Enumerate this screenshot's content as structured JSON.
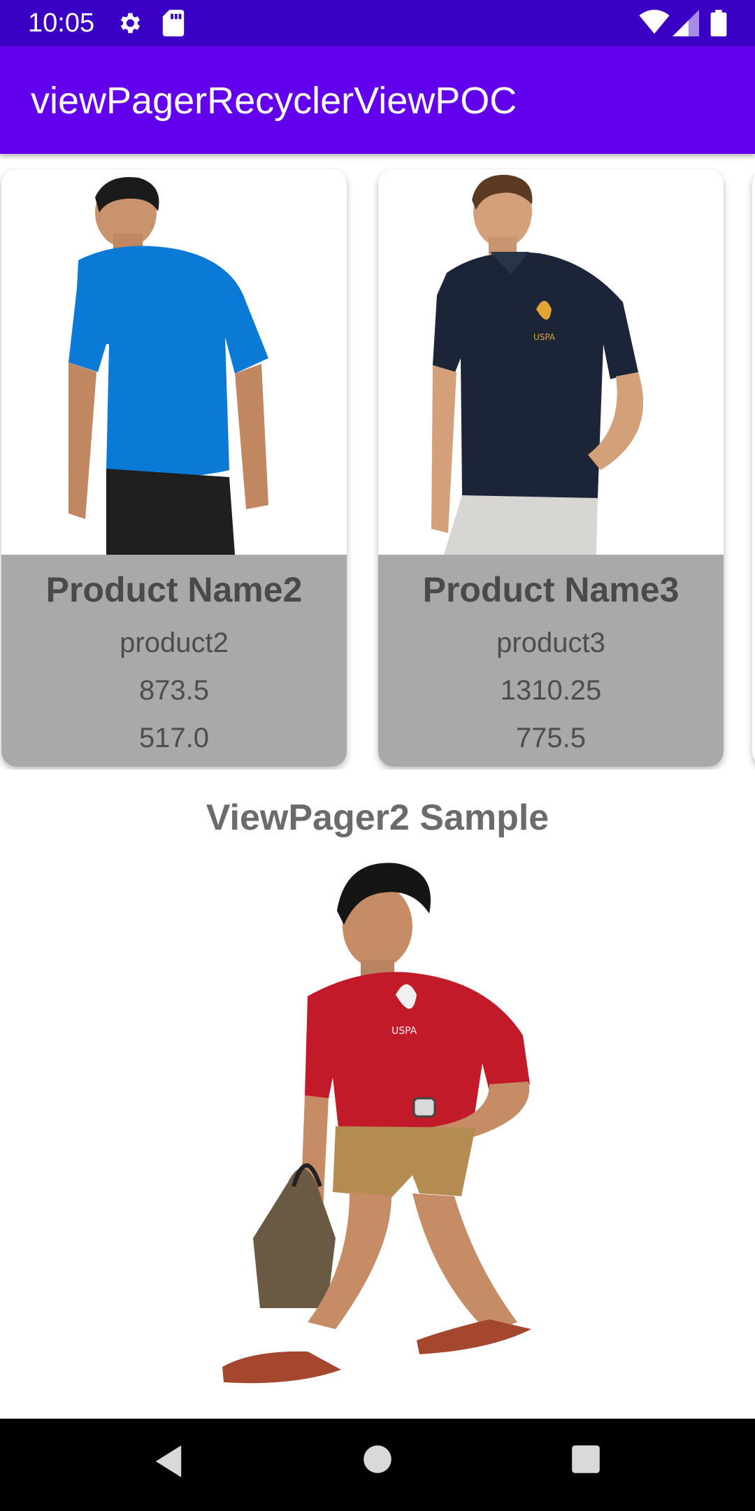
{
  "status_bar": {
    "time": "10:05",
    "icons": [
      "settings-icon",
      "sd-card-icon",
      "wifi-icon",
      "signal-icon",
      "battery-icon"
    ]
  },
  "app_bar": {
    "title": "viewPagerRecyclerViewPOC"
  },
  "products": [
    {
      "name": "Product Name2",
      "code": "product2",
      "price": "873.5",
      "discount": "517.0",
      "shirt_color": "#0a7ad6"
    },
    {
      "name": "Product Name3",
      "code": "product3",
      "price": "1310.25",
      "discount": "775.5",
      "shirt_color": "#1c2537"
    }
  ],
  "viewpager": {
    "title": "ViewPager2 Sample",
    "shirt_color": "#c31a2a"
  },
  "nav_bar": {
    "buttons": [
      "back-icon",
      "home-icon",
      "recents-icon"
    ]
  },
  "colors": {
    "primary": "#6200ee",
    "primary_dark": "#3a00c4",
    "card_footer": "#a9a9a9"
  }
}
